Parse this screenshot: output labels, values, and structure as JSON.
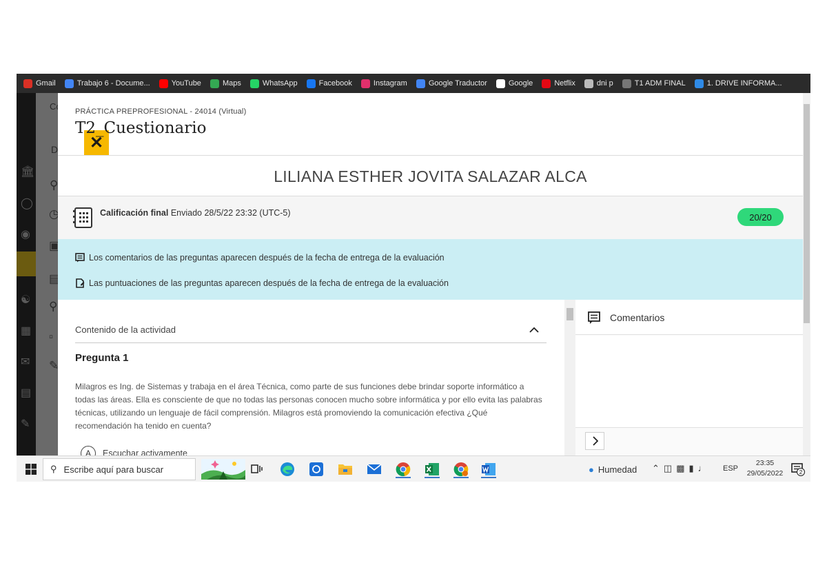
{
  "bookmarks": [
    {
      "label": "Gmail",
      "icon": "gmail-icon",
      "color": "#d93025"
    },
    {
      "label": "Trabajo 6 - Docume...",
      "icon": "docs-icon",
      "color": "#4285f4"
    },
    {
      "label": "YouTube",
      "icon": "youtube-icon",
      "color": "#ff0000"
    },
    {
      "label": "Maps",
      "icon": "maps-icon",
      "color": "#34a853"
    },
    {
      "label": "WhatsApp",
      "icon": "whatsapp-icon",
      "color": "#25d366"
    },
    {
      "label": "Facebook",
      "icon": "facebook-icon",
      "color": "#1877f2"
    },
    {
      "label": "Instagram",
      "icon": "instagram-icon",
      "color": "#e1306c"
    },
    {
      "label": "Google Traductor",
      "icon": "translate-icon",
      "color": "#4285f4"
    },
    {
      "label": "Google",
      "icon": "google-icon",
      "color": "#ffffff"
    },
    {
      "label": "Netflix",
      "icon": "netflix-icon",
      "color": "#e50914"
    },
    {
      "label": "dni p",
      "icon": "dni-icon",
      "color": "#bbbbbb"
    },
    {
      "label": "T1 ADM FINAL",
      "icon": "globe-icon",
      "color": "#777777"
    },
    {
      "label": "1. DRIVE INFORMA...",
      "icon": "onedrive-icon",
      "color": "#2f8ae6"
    }
  ],
  "background": {
    "partial_text_1": "Co",
    "partial_text_2": "D"
  },
  "panel": {
    "course_name": "PRÁCTICA PREPROFESIONAL - 24014 (Virtual)",
    "activity_title": "T2_Cuestionario",
    "student_name": "LILIANA ESTHER JOVITA SALAZAR ALCA",
    "grade": {
      "label": "Calificación final",
      "submitted": "Enviado 28/5/22 23:32 (UTC-5)",
      "score": "20/20",
      "score_color": "#2fd87a"
    },
    "notices": [
      "Los comentarios de las preguntas aparecen después de la fecha de entrega de la evaluación",
      "Las puntuaciones de las preguntas aparecen después de la fecha de entrega de la evaluación"
    ],
    "banner_color": "#cbeef4",
    "content": {
      "section_header": "Contenido de la actividad",
      "question_title": "Pregunta 1",
      "question_text": "Milagros es Ing. de Sistemas y trabaja en el área Técnica, como parte de sus funciones debe brindar soporte informático a todas las áreas. Ella es consciente de que no todas las personas conocen mucho sobre informática y por ello evita las palabras técnicas, utilizando un lenguaje de fácil comprensión. Milagros está promoviendo la comunicación efectiva ¿Qué recomendación ha tenido en cuenta?",
      "option_letter": "A",
      "option_text": "Escuchar activamente"
    },
    "comments": {
      "title": "Comentarios"
    }
  },
  "taskbar": {
    "search_placeholder": "Escribe aquí para buscar",
    "weather": "Humedad",
    "language": "ESP",
    "time": "23:35",
    "date": "29/05/2022",
    "notification_count": "2"
  }
}
